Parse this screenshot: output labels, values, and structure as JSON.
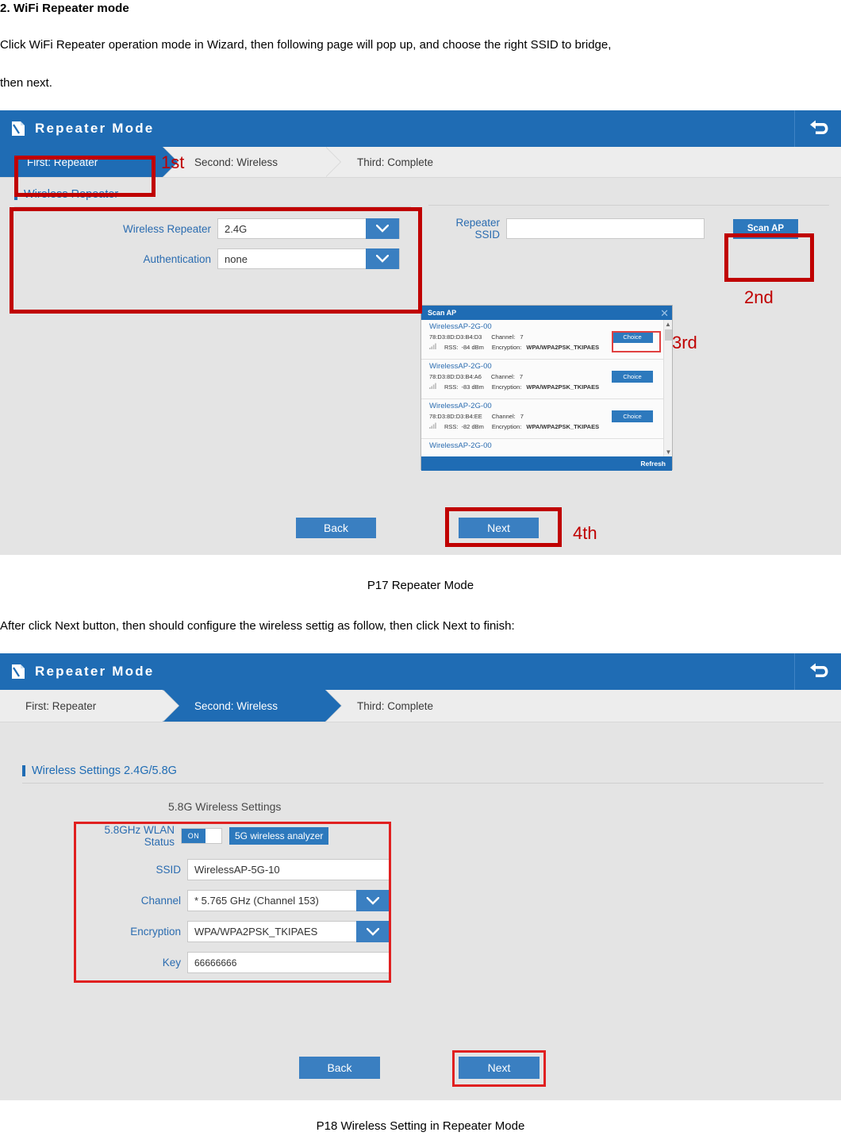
{
  "document": {
    "heading": "2. WiFi Repeater mode",
    "paragraph1": "Click WiFi Repeater operation mode in Wizard, then following page will pop up, and choose the right SSID to bridge,",
    "paragraph2": "then next.",
    "caption1": "P17 Repeater Mode",
    "paragraph3": "After click Next button, then should configure the wireless settig as follow, then click Next to finish:",
    "caption2": "P18 Wireless Setting in Repeater Mode"
  },
  "colors": {
    "header_blue": "#1f6cb4",
    "button_blue": "#3a7fc1",
    "annotation_red": "#c00000",
    "panel_gray": "#e4e4e4",
    "label_blue": "#2b6cb0"
  },
  "panel1": {
    "header": {
      "title": "Repeater Mode",
      "brand_icon": "page-flip-icon",
      "back_icon": "undo-arrow-icon"
    },
    "steps": [
      {
        "label": "First: Repeater",
        "active": true
      },
      {
        "label": "Second: Wireless",
        "active": false
      },
      {
        "label": "Third: Complete",
        "active": false
      }
    ],
    "section_title": "Wireless Repeater",
    "fields": {
      "wireless_repeater_label": "Wireless Repeater",
      "wireless_repeater_value": "2.4G",
      "authentication_label": "Authentication",
      "authentication_value": "none",
      "repeater_ssid_label": "Repeater SSID",
      "repeater_ssid_value": "",
      "repeater_ssid_placeholder": ""
    },
    "scan_ap_button": "Scan AP",
    "buttons": {
      "back": "Back",
      "next": "Next"
    },
    "annotations": [
      {
        "id": "1st",
        "label": "1st"
      },
      {
        "id": "2nd",
        "label": "2nd"
      },
      {
        "id": "3rd",
        "label": "3rd"
      },
      {
        "id": "4th",
        "label": "4th"
      }
    ],
    "scan_dialog": {
      "title": "Scan AP",
      "close_icon": "close-icon",
      "refresh_label": "Refresh",
      "columns": {
        "channel": "Channel:",
        "rss": "RSS:",
        "encryption": "Encryption:"
      },
      "rows": [
        {
          "ssid": "WirelessAP-2G-00",
          "mac": "78:D3:8D:D3:B4:D3",
          "channel_label": "Channel:",
          "channel": "7",
          "rss_label": "RSS:",
          "rss": "-84 dBm",
          "encryption_label": "Encryption:",
          "encryption": "WPA/WPA2PSK_TKIPAES",
          "choice": "Choice"
        },
        {
          "ssid": "WirelessAP-2G-00",
          "mac": "78:D3:8D:D3:B4:A6",
          "channel_label": "Channel:",
          "channel": "7",
          "rss_label": "RSS:",
          "rss": "-83 dBm",
          "encryption_label": "Encryption:",
          "encryption": "WPA/WPA2PSK_TKIPAES",
          "choice": "Choice"
        },
        {
          "ssid": "WirelessAP-2G-00",
          "mac": "78:D3:8D:D3:B4:EE",
          "channel_label": "Channel:",
          "channel": "7",
          "rss_label": "RSS:",
          "rss": "-82 dBm",
          "encryption_label": "Encryption:",
          "encryption": "WPA/WPA2PSK_TKIPAES",
          "choice": "Choice"
        }
      ],
      "partial_row_ssid": "WirelessAP-2G-00"
    }
  },
  "panel2": {
    "header": {
      "title": "Repeater Mode",
      "brand_icon": "page-flip-icon",
      "back_icon": "undo-arrow-icon"
    },
    "steps": [
      {
        "label": "First: Repeater",
        "active": false
      },
      {
        "label": "Second: Wireless",
        "active": true
      },
      {
        "label": "Third: Complete",
        "active": false
      }
    ],
    "section_title": "Wireless Settings 2.4G/5.8G",
    "subsection_title": "5.8G Wireless Settings",
    "fields": {
      "wlan_status_label": "5.8GHz WLAN Status",
      "wlan_status_value": "ON",
      "analyzer_button": "5G wireless analyzer",
      "ssid_label": "SSID",
      "ssid_value": "WirelessAP-5G-10",
      "channel_label": "Channel",
      "channel_value": "* 5.765 GHz (Channel 153)",
      "encryption_label": "Encryption",
      "encryption_value": "WPA/WPA2PSK_TKIPAES",
      "key_label": "Key",
      "key_value": "66666666"
    },
    "buttons": {
      "back": "Back",
      "next": "Next"
    }
  }
}
